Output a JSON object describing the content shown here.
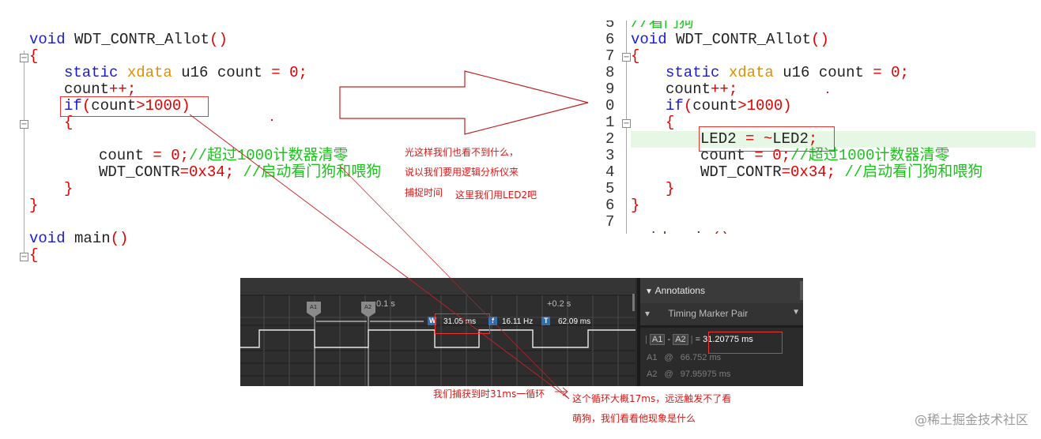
{
  "left_code": {
    "lines": [
      "void WDT_CONTR_Allot()",
      "{",
      "static xdata u16 count = 0;",
      "count++;",
      "if(count>1000)",
      "{",
      "count = 0;//超过1000计数器清零",
      "WDT_CONTR=0x34; //启动看门狗和喂狗",
      "}",
      "}",
      "void main()",
      "{"
    ]
  },
  "right_code": {
    "line_numbers": [
      "5",
      "6",
      "7",
      "8",
      "9",
      "0",
      "1",
      "2",
      "3",
      "4",
      "5",
      "6",
      "7"
    ],
    "lines": [
      "//看门狗",
      "void WDT_CONTR_Allot()",
      "{",
      "static xdata u16 count = 0;",
      "count++;",
      "if(count>1000)",
      "{",
      "LED2 = ~LED2;",
      "count = 0;//超过1000计数器清零",
      "WDT_CONTR=0x34; //启动看门狗和喂狗",
      "}",
      "}",
      "void main()"
    ]
  },
  "notes": {
    "top1": "光这样我们也看不到什么，",
    "top2": "说以我们要用逻辑分析仪来",
    "top3": "捕捉时间",
    "top4": "这里我们用LED2吧",
    "bottom_left": "我们捕获到时31ms一循环",
    "bottom_right1": "这个循环大概17ms，远远触发不了看",
    "bottom_right2": "萌狗，我们看看他现象是什么"
  },
  "analyzer": {
    "tick1": "0.1 s",
    "tick2": "+0.2 s",
    "marker_a1": "A1",
    "marker_a2": "A2",
    "width_badge": "W",
    "width_value": "31.05 ms",
    "freq_badge": "f",
    "freq_value": "16.11 Hz",
    "period_badge": "T",
    "period_value": "62.09 ms",
    "panel_title": "Annotations",
    "panel_item": "Timing Marker Pair",
    "pair_a1": "A1",
    "pair_dash": "-",
    "pair_a2": "A2",
    "pair_eq": "=",
    "pair_value": "31.20775 ms",
    "a1_label": "A1",
    "a1_at": "@",
    "a1_value": "66.752 ms",
    "a2_label": "A2",
    "a2_at": "@",
    "a2_value": "97.95975 ms"
  },
  "watermark": "@稀土掘金技术社区",
  "colors": {
    "keyword": "#1a1adb",
    "type": "#e08f00",
    "number": "#e00000",
    "comment": "#1cc21c",
    "annotation": "#d61818",
    "analyzer_bg": "#2b2b2b",
    "highlight_line": "#e6f7e6"
  }
}
